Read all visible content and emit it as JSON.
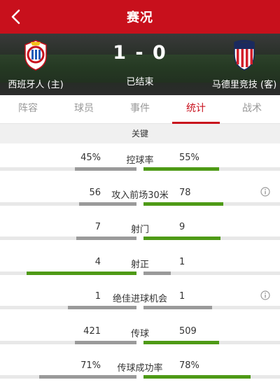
{
  "header": {
    "title": "赛况"
  },
  "match": {
    "home_team": "西班牙人 (主)",
    "away_team": "马德里竞技 (客)",
    "score": "1 - 0",
    "status": "已结束"
  },
  "tabs": [
    {
      "label": "阵容",
      "active": false
    },
    {
      "label": "球员",
      "active": false
    },
    {
      "label": "事件",
      "active": false
    },
    {
      "label": "统计",
      "active": true
    },
    {
      "label": "战术",
      "active": false
    }
  ],
  "section": {
    "title": "关键"
  },
  "colors": {
    "brand_red": "#c8101c",
    "win_green": "#4e9a16",
    "loss_gray": "#9a9a9a"
  },
  "stats": [
    {
      "label": "控球率",
      "home": "45%",
      "away": "55%",
      "home_share": 0.45,
      "away_share": 0.55,
      "info": false
    },
    {
      "label": "攻入前场30米",
      "home": "56",
      "away": "78",
      "home_share": 0.42,
      "away_share": 0.58,
      "info": true
    },
    {
      "label": "射门",
      "home": "7",
      "away": "9",
      "home_share": 0.44,
      "away_share": 0.56,
      "info": false
    },
    {
      "label": "射正",
      "home": "4",
      "away": "1",
      "home_share": 0.8,
      "away_share": 0.2,
      "info": false
    },
    {
      "label": "绝佳进球机会",
      "home": "1",
      "away": "1",
      "home_share": 0.5,
      "away_share": 0.5,
      "info": true
    },
    {
      "label": "传球",
      "home": "421",
      "away": "509",
      "home_share": 0.45,
      "away_share": 0.55,
      "info": false
    },
    {
      "label": "传球成功率",
      "home": "71%",
      "away": "78%",
      "home_share": 0.71,
      "away_share": 0.78,
      "info": false
    }
  ]
}
